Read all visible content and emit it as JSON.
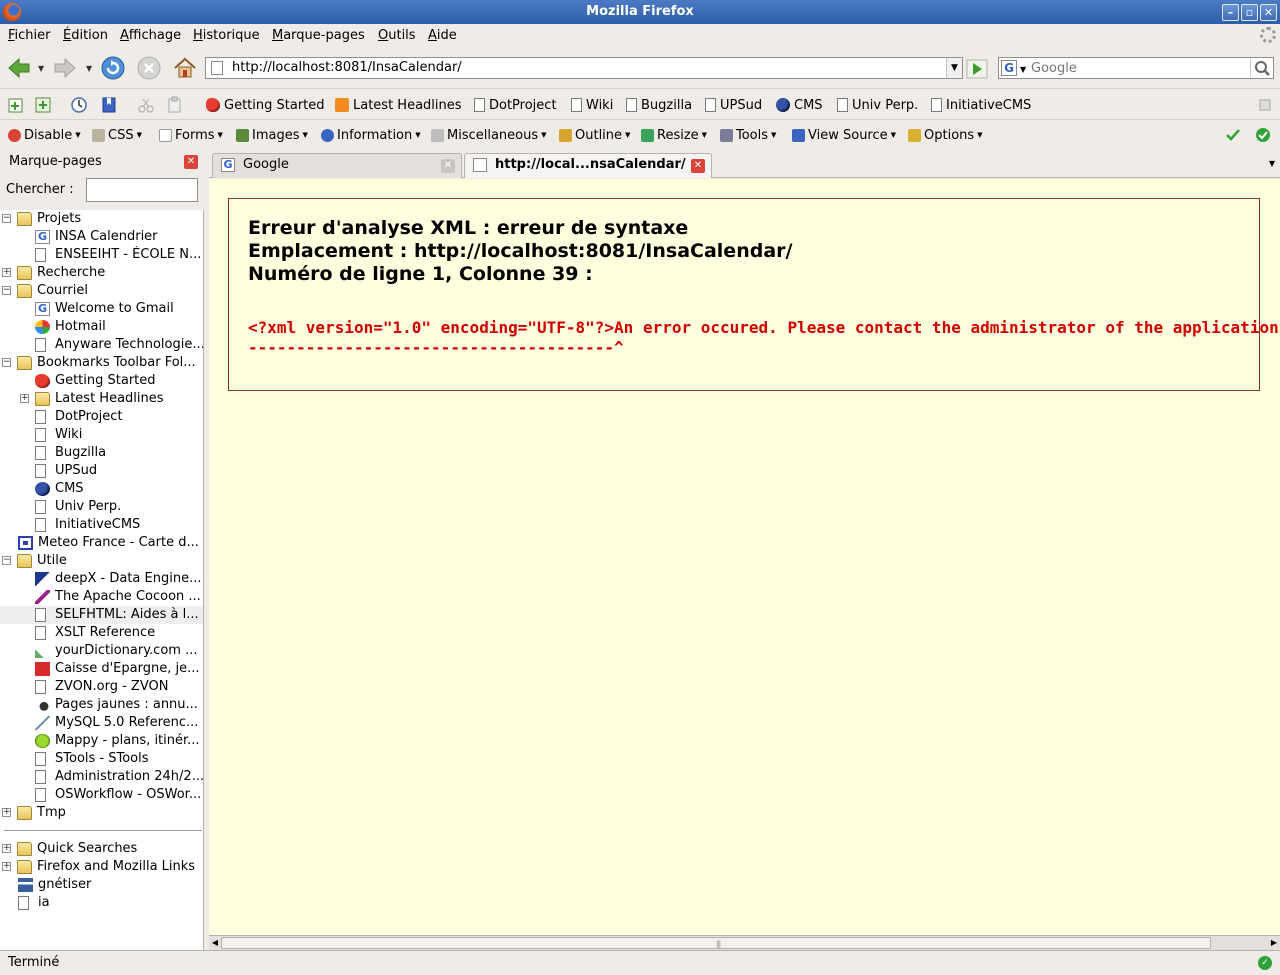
{
  "window": {
    "title": "Mozilla Firefox",
    "controls": [
      "minimize",
      "maximize",
      "close"
    ]
  },
  "menubar": [
    {
      "label": "Fichier",
      "accel": "F",
      "rest": "ichier"
    },
    {
      "label": "Édition",
      "accel": "É",
      "rest": "dition"
    },
    {
      "label": "Affichage",
      "accel": "A",
      "rest": "ffichage"
    },
    {
      "label": "Historique",
      "accel": "H",
      "rest": "istorique"
    },
    {
      "label": "Marque-pages",
      "accel": "M",
      "rest": "arque-pages"
    },
    {
      "label": "Outils",
      "accel": "O",
      "rest": "utils"
    },
    {
      "label": "Aide",
      "accel": "A",
      "rest": "ide"
    }
  ],
  "navbar": {
    "url": "http://localhost:8081/InsaCalendar/",
    "search_placeholder": "Google",
    "search_engine": "G"
  },
  "bookmarks_toolbar": [
    {
      "label": "Getting Started",
      "icon": "red-icon"
    },
    {
      "label": "Latest Headlines",
      "icon": "rss-icon"
    },
    {
      "label": "DotProject",
      "icon": "doc-icon"
    },
    {
      "label": "Wiki",
      "icon": "doc-icon"
    },
    {
      "label": "Bugzilla",
      "icon": "doc-icon"
    },
    {
      "label": "UPSud",
      "icon": "doc-icon"
    },
    {
      "label": "CMS",
      "icon": "cms-icon"
    },
    {
      "label": "Univ Perp.",
      "icon": "doc-icon"
    },
    {
      "label": "InitiativeCMS",
      "icon": "doc-icon"
    }
  ],
  "dev_toolbar": [
    {
      "label": "Disable",
      "color": "#d9443a"
    },
    {
      "label": "CSS",
      "color": "#b9b3a0"
    },
    {
      "label": "Forms",
      "color": "#c8c8c8"
    },
    {
      "label": "Images",
      "color": "#5b8a3a"
    },
    {
      "label": "Information",
      "color": "#3a63c2"
    },
    {
      "label": "Miscellaneous",
      "color": "#9a9a9a"
    },
    {
      "label": "Outline",
      "color": "#d9a330"
    },
    {
      "label": "Resize",
      "color": "#3aa35b"
    },
    {
      "label": "Tools",
      "color": "#7b7b9a"
    },
    {
      "label": "View Source",
      "color": "#3a63c2"
    },
    {
      "label": "Options",
      "color": "#d9b030"
    }
  ],
  "sidebar": {
    "title": "Marque-pages",
    "search_label": "Chercher  :",
    "search_value": "",
    "tree": [
      {
        "label": "Projets",
        "type": "folder",
        "depth": 0,
        "twisty": "−"
      },
      {
        "label": "INSA Calendrier",
        "type": "google",
        "depth": 1
      },
      {
        "label": "ENSEEIHT - ÉCOLE N...",
        "type": "doc",
        "depth": 1
      },
      {
        "label": "Recherche",
        "type": "folder",
        "depth": 0,
        "twisty": "+"
      },
      {
        "label": "Courriel",
        "type": "folder",
        "depth": 0,
        "twisty": "−"
      },
      {
        "label": "Welcome to Gmail",
        "type": "google",
        "depth": 1
      },
      {
        "label": "Hotmail",
        "type": "msn",
        "depth": 1
      },
      {
        "label": "Anyware Technologie...",
        "type": "doc",
        "depth": 1
      },
      {
        "label": "Bookmarks Toolbar Fol...",
        "type": "folder",
        "depth": 0,
        "twisty": "−"
      },
      {
        "label": "Getting Started",
        "type": "red",
        "depth": 1
      },
      {
        "label": "Latest Headlines",
        "type": "folder",
        "depth": 1,
        "twisty": "+"
      },
      {
        "label": "DotProject",
        "type": "doc",
        "depth": 1
      },
      {
        "label": "Wiki",
        "type": "doc",
        "depth": 1
      },
      {
        "label": "Bugzilla",
        "type": "doc",
        "depth": 1
      },
      {
        "label": "UPSud",
        "type": "doc",
        "depth": 1
      },
      {
        "label": "CMS",
        "type": "cms",
        "depth": 1
      },
      {
        "label": "Univ Perp.",
        "type": "doc",
        "depth": 1
      },
      {
        "label": "InitiativeCMS",
        "type": "doc",
        "depth": 1
      },
      {
        "label": "Meteo France - Carte d...",
        "type": "meteo",
        "depth": 0
      },
      {
        "label": "Utile",
        "type": "folder",
        "depth": 0,
        "twisty": "−"
      },
      {
        "label": "deepX - Data Engine...",
        "type": "deepx",
        "depth": 1
      },
      {
        "label": "The Apache Cocoon ...",
        "type": "feather",
        "depth": 1
      },
      {
        "label": "SELFHTML: Aides à l...",
        "type": "doc",
        "depth": 1,
        "selected": true
      },
      {
        "label": "XSLT Reference",
        "type": "doc",
        "depth": 1
      },
      {
        "label": "yourDictionary.com ...",
        "type": "dict",
        "depth": 1
      },
      {
        "label": "Caisse d'Epargne, je...",
        "type": "caisse",
        "depth": 1
      },
      {
        "label": "ZVON.org - ZVON",
        "type": "doc",
        "depth": 1
      },
      {
        "label": "Pages jaunes : annu...",
        "type": "pj",
        "depth": 1
      },
      {
        "label": "MySQL 5.0 Referenc...",
        "type": "mysql",
        "depth": 1
      },
      {
        "label": "Mappy - plans, itinér...",
        "type": "mappy",
        "depth": 1
      },
      {
        "label": "STools - STools",
        "type": "doc",
        "depth": 1
      },
      {
        "label": "Administration 24h/2...",
        "type": "doc",
        "depth": 1
      },
      {
        "label": "OSWorkflow - OSWor...",
        "type": "doc",
        "depth": 1
      },
      {
        "label": "Tmp",
        "type": "folder",
        "depth": 0,
        "twisty": "+"
      },
      {
        "label": "",
        "type": "separator",
        "depth": 0
      },
      {
        "label": "Quick Searches",
        "type": "folder",
        "depth": 0,
        "twisty": "+"
      },
      {
        "label": "Firefox and Mozilla Links",
        "type": "folder",
        "depth": 0,
        "twisty": "+"
      },
      {
        "label": "gnétiser",
        "type": "gnet",
        "depth": 0
      },
      {
        "label": "ia",
        "type": "doc",
        "depth": 0
      }
    ]
  },
  "tabs": [
    {
      "label": "Google",
      "icon": "G",
      "active": false
    },
    {
      "label": "http://local...nsaCalendar/",
      "icon": "",
      "active": true
    }
  ],
  "content": {
    "error_title": "Erreur d'analyse XML : erreur de syntaxe",
    "error_location": "Emplacement : http://localhost:8081/InsaCalendar/",
    "error_line": "Numéro de ligne 1, Colonne 39 :",
    "source_line": "<?xml version=\"1.0\" encoding=\"UTF-8\"?>An error occured. Please contact the administrator of the application.",
    "pointer_line": "--------------------------------------^"
  },
  "status": {
    "text": "Terminé"
  }
}
